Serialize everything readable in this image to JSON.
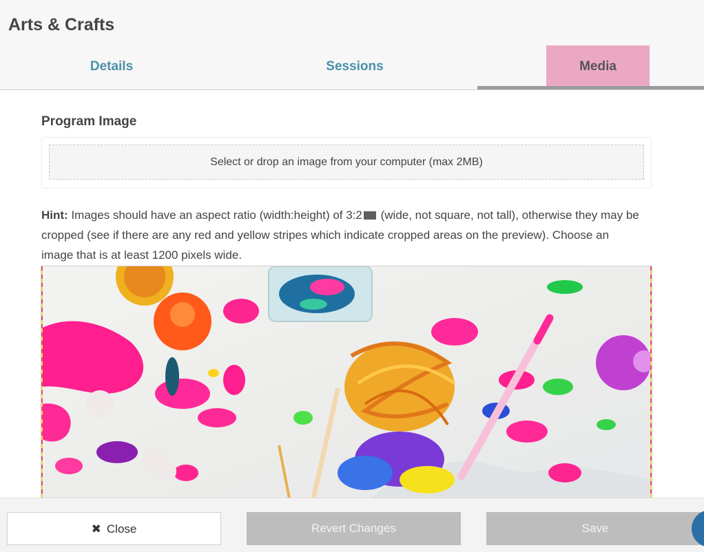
{
  "app": {
    "title": "Arts & Crafts"
  },
  "tabs": [
    {
      "label": "Details",
      "active": false
    },
    {
      "label": "Sessions",
      "active": false
    },
    {
      "label": "Media",
      "active": true
    }
  ],
  "media": {
    "section_title": "Program Image",
    "dropzone_text": "Select or drop an image from your computer (max 2MB)",
    "hint": {
      "label": "Hint:",
      "text_before": "Images should have an aspect ratio (width:height) of 3:2",
      "text_after": "(wide, not square, not tall), otherwise they may be cropped (see if there are any red and yellow stripes which indicate cropped areas on the preview). Choose an image that is at least 1200 pixels wide."
    }
  },
  "footer": {
    "close_label": "Close",
    "revert_label": "Revert Changes",
    "save_label": "Save"
  },
  "colors": {
    "accent_tab": "#4a90a8",
    "active_tab_bg": "#eba8c3",
    "disabled_button": "#bdbdbd"
  },
  "icons": {
    "close": "close-icon"
  }
}
